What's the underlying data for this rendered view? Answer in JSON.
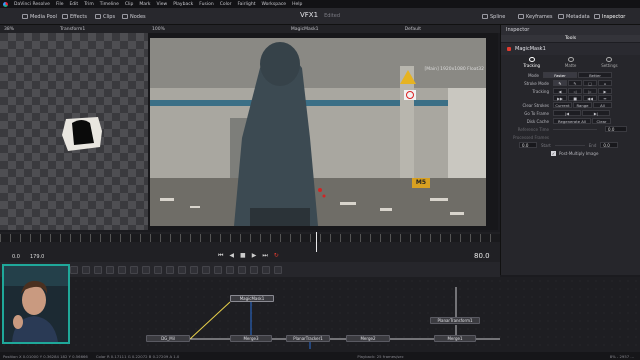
{
  "menubar": [
    "DaVinci Resolve",
    "File",
    "Edit",
    "Trim",
    "Timeline",
    "Clip",
    "Mark",
    "View",
    "Playback",
    "Fusion",
    "Color",
    "Fairlight",
    "Workspace",
    "Help"
  ],
  "toolbar": {
    "left": [
      "Media Pool",
      "Effects",
      "Clips",
      "Nodes"
    ],
    "right": [
      "Spline",
      "Keyframes",
      "Metadata",
      "Inspector"
    ],
    "project_title": "VFX1",
    "edited": "Edited"
  },
  "viewer_left": {
    "zoom": "38%",
    "node": "Transform1"
  },
  "viewer_main": {
    "zoom": "100%",
    "node": "MagicMask1",
    "lut": "Default",
    "resolution": "[Main] 1920x1080 Float32",
    "sign_text": "M5"
  },
  "inspector": {
    "tab": "Tools",
    "node": "MagicMask1",
    "subtabs": [
      "Tracking",
      "Matte",
      "Settings"
    ],
    "mode_label": "Mode",
    "mode_options": [
      "Faster",
      "Better"
    ],
    "mode_selected": "Faster",
    "stroke_mode_label": "Stroke Mode",
    "tracking_label": "Tracking",
    "clear_strokes_label": "Clear Strokes",
    "clear_strokes_options": [
      "Current",
      "Range",
      "All"
    ],
    "go_to_frame_label": "Go To Frame",
    "disk_cache_label": "Disk Cache",
    "disk_cache_buttons": [
      "Regenerate All",
      "Clear"
    ],
    "reference_time_label": "Reference Time",
    "reference_time_value": "0.0",
    "processed_frames_label": "Processed Frames",
    "processed_frames_values": [
      "0.0",
      "Start",
      "End",
      "0.0"
    ],
    "post_multiply_label": "Post-Multiply Image"
  },
  "transport": {
    "start": "0.0",
    "end": "179.0",
    "current": "80.0"
  },
  "flow_nodes": [
    "MagicMask1",
    "DG_Mil",
    "Merge3",
    "PlanarTracker1",
    "Merge2",
    "Merge1",
    "PlanarTransform1"
  ],
  "status": {
    "position": "Position X 0.01000 Y 0.36284 182 Y 0.56666",
    "color": "Color R 0.17111 G 0.22072 B 0.27209 A 1.0",
    "playback": "Playback: 25 frames/sec",
    "zoom_readout": "8% - 2957 ..."
  },
  "colors": {
    "accent": "#e13b2f",
    "webcam_border": "#1fa89a",
    "panel": "#26262b"
  }
}
